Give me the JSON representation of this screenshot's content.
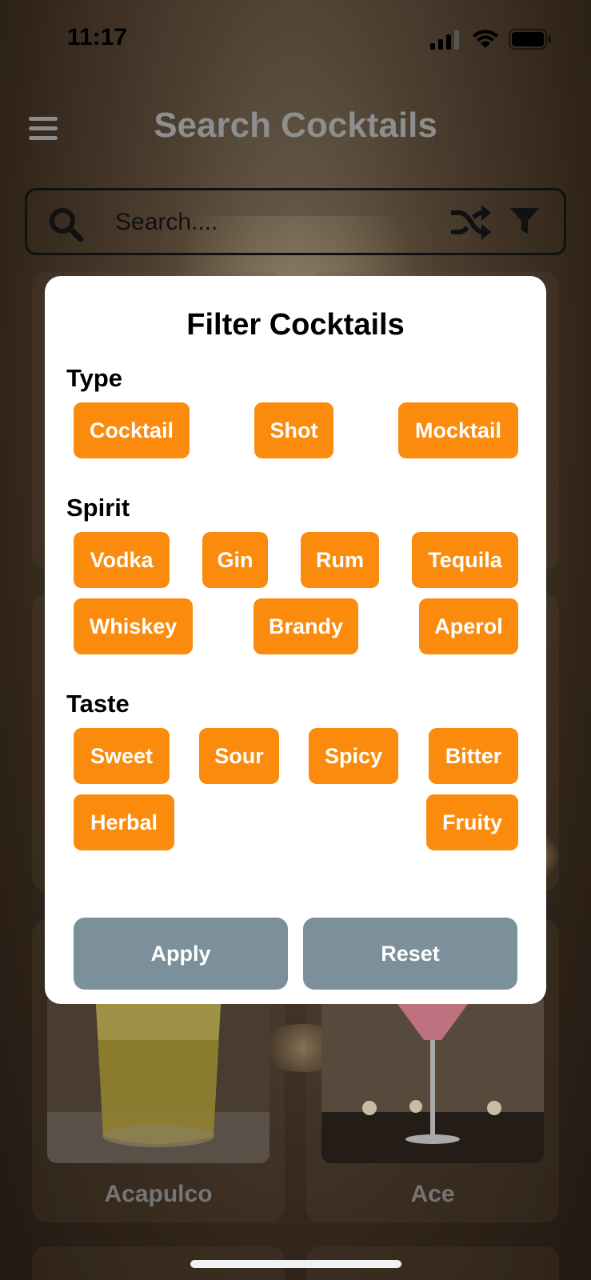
{
  "status_bar": {
    "time": "11:17"
  },
  "header": {
    "title": "Search Cocktails"
  },
  "search": {
    "placeholder": "Search...."
  },
  "modal": {
    "title": "Filter Cocktails",
    "sections": {
      "type": {
        "title": "Type",
        "chips": [
          "Cocktail",
          "Shot",
          "Mocktail"
        ]
      },
      "spirit": {
        "title": "Spirit",
        "chips": [
          "Vodka",
          "Gin",
          "Rum",
          "Tequila",
          "Whiskey",
          "Brandy",
          "Aperol"
        ]
      },
      "taste": {
        "title": "Taste",
        "chips": [
          "Sweet",
          "Sour",
          "Spicy",
          "Bitter",
          "Herbal",
          "Fruity"
        ]
      }
    },
    "apply_label": "Apply",
    "reset_label": "Reset"
  },
  "cards": [
    {
      "name": "Acapulco"
    },
    {
      "name": "Ace"
    }
  ],
  "colors": {
    "chip": "#fb8b0d",
    "action_button": "#7b909a",
    "title_gray": "#8e8e8e"
  }
}
